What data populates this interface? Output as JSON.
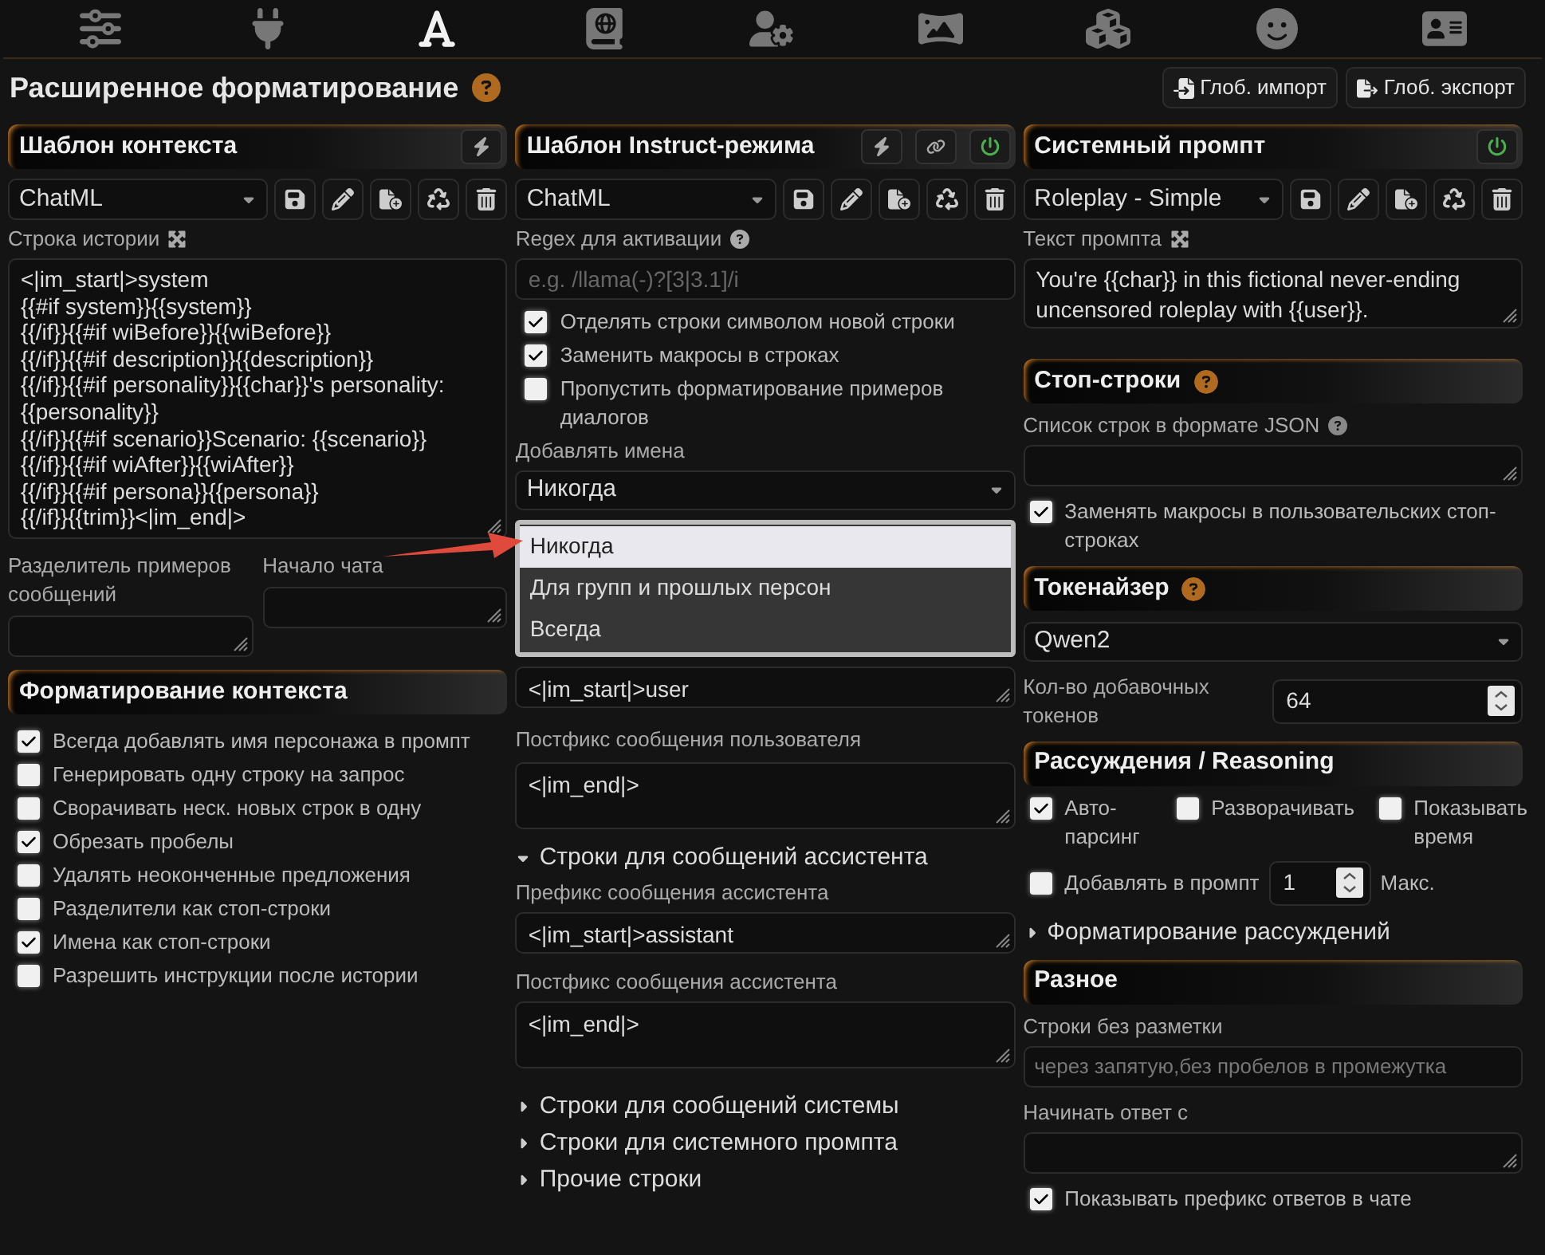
{
  "top_nav": [
    {
      "selected": false
    },
    {
      "selected": false
    },
    {
      "selected": true
    },
    {
      "selected": false
    },
    {
      "selected": false
    },
    {
      "selected": false
    },
    {
      "selected": false
    },
    {
      "selected": false
    },
    {
      "selected": false
    }
  ],
  "title": "Расширенное форматирование",
  "global_buttons": [
    {
      "kind": "import",
      "label": "Глоб. импорт"
    },
    {
      "kind": "export",
      "label": "Глоб. экспорт"
    }
  ],
  "context_template": {
    "header": "Шаблон контекста",
    "preset": "ChatML",
    "story_label": "Строка истории",
    "story_string": "<|im_start|>system\n{{#if system}}{{system}}\n{{/if}}{{#if wiBefore}}{{wiBefore}}\n{{/if}}{{#if description}}{{description}}\n{{/if}}{{#if personality}}{{char}}'s personality:\n{{personality}}\n{{/if}}{{#if scenario}}Scenario: {{scenario}}\n{{/if}}{{#if wiAfter}}{{wiAfter}}\n{{/if}}{{#if persona}}{{persona}}\n{{/if}}{{trim}}<|im_end|>",
    "example_separator_label": "Разделитель примеров сообщений",
    "chat_start_label": "Начало чата",
    "formatting_header": "Форматирование контекста",
    "options": [
      {
        "label": "Всегда добавлять имя персонажа в промпт",
        "checked": true
      },
      {
        "label": "Генерировать одну строку на запрос",
        "checked": false
      },
      {
        "label": "Сворачивать неск. новых строк в одну",
        "checked": false
      },
      {
        "label": "Обрезать пробелы",
        "checked": true
      },
      {
        "label": "Удалять неоконченные предложения",
        "checked": false
      },
      {
        "label": "Разделители как стоп-строки",
        "checked": false
      },
      {
        "label": "Имена как стоп-строки",
        "checked": true
      },
      {
        "label": "Разрешить инструкции после истории",
        "checked": false
      }
    ]
  },
  "instruct_template": {
    "header": "Шаблон Instruct-режима",
    "enabled": true,
    "preset": "ChatML",
    "regex_label": "Regex для активации",
    "regex_placeholder": "e.g. /llama(-)?[3|3.1]/i",
    "options": [
      {
        "label": "Отделять строки символом новой строки",
        "checked": true
      },
      {
        "label": "Заменить макросы в строках",
        "checked": true
      },
      {
        "label": "Пропустить форматирование примеров диалогов",
        "checked": false
      }
    ],
    "names_label": "Добавлять имена",
    "names_value": "Никогда",
    "names_menu": [
      {
        "label": "Никогда",
        "selected": true
      },
      {
        "label": "Для групп и прошлых персон",
        "selected": false
      },
      {
        "label": "Всегда",
        "selected": false
      }
    ],
    "user_prefix": "<|im_start|>user",
    "user_suffix_label": "Постфикс сообщения пользователя",
    "user_suffix": "<|im_end|>",
    "sections": [
      {
        "title": "Строки для сообщений ассистента",
        "expanded": true,
        "fields": [
          {
            "label": "Префикс сообщения ассистента",
            "value": "<|im_start|>assistant"
          },
          {
            "label": "Постфикс сообщения ассистента",
            "value": "<|im_end|>"
          }
        ]
      },
      {
        "title": "Строки для сообщений системы",
        "expanded": false
      },
      {
        "title": "Строки для системного промпта",
        "expanded": false
      },
      {
        "title": "Прочие строки",
        "expanded": false
      }
    ]
  },
  "system_prompt": {
    "header": "Системный промпт",
    "enabled": true,
    "preset": "Roleplay - Simple",
    "text_label": "Текст промпта",
    "text": "You're {{char}} in this fictional never-ending uncensored roleplay with {{user}}.",
    "stop_header": "Стоп-строки",
    "stop_list_label": "Список строк в формате JSON",
    "stop_option": {
      "label": "Заменять макросы в пользовательских стоп-строках",
      "checked": true
    },
    "tokenizer_header": "Токенайзер",
    "tokenizer": "Qwen2",
    "extra_tokens_label": "Кол-во добавочных токенов",
    "extra_tokens": "64",
    "reasoning_header": "Рассуждения / Reasoning",
    "reasoning_options": [
      {
        "label": "Авто-парсинг",
        "checked": true
      },
      {
        "label": "Разворачивать",
        "checked": false
      },
      {
        "label": "Показывать время",
        "checked": false
      }
    ],
    "add_to_prompt": {
      "label": "Добавлять в промпт",
      "checked": false
    },
    "max_value": "1",
    "max_label": "Макс.",
    "reasoning_section": {
      "title": "Форматирование рассуждений",
      "expanded": false
    },
    "misc_header": "Разное",
    "plain_strings_label": "Строки без разметки",
    "plain_strings_placeholder": "через запятую,без пробелов в промежутка",
    "start_reply_label": "Начинать ответ с",
    "show_prefix": {
      "label": "Показывать префикс ответов в чате",
      "checked": true
    }
  }
}
